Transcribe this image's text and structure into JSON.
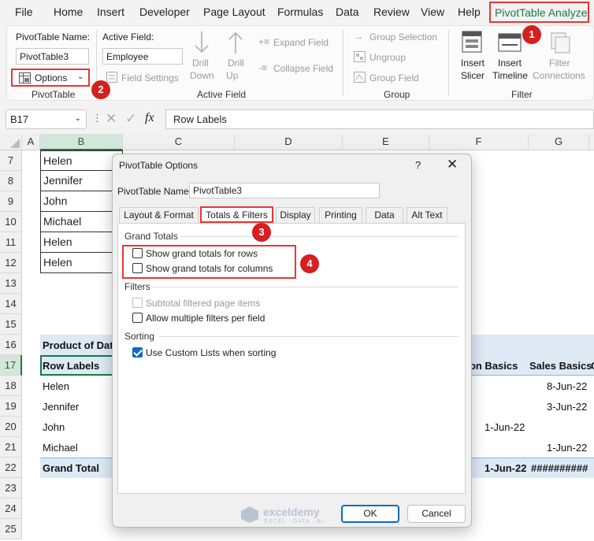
{
  "menu": {
    "items": [
      "File",
      "Home",
      "Insert",
      "Developer",
      "Page Layout",
      "Formulas",
      "Data",
      "Review",
      "View",
      "Help"
    ],
    "active": "PivotTable Analyze"
  },
  "ribbon": {
    "pivottable": {
      "name_label": "PivotTable Name:",
      "name_value": "PivotTable3",
      "options_label": "Options",
      "group_label": "PivotTable"
    },
    "active_field": {
      "label": "Active Field:",
      "value": "Employee",
      "field_settings": "Field Settings",
      "drill_down": [
        "Drill",
        "Down"
      ],
      "drill_up": [
        "Drill",
        "Up"
      ],
      "expand_field": "Expand Field",
      "collapse_field": "Collapse Field",
      "group_label": "Active Field"
    },
    "group": {
      "group_selection": "Group Selection",
      "ungroup": "Ungroup",
      "group_field": "Group Field",
      "group_label": "Group"
    },
    "filter": {
      "insert_slicer": [
        "Insert",
        "Slicer"
      ],
      "insert_timeline": [
        "Insert",
        "Timeline"
      ],
      "filter_connections": [
        "Filter",
        "Connections"
      ],
      "group_label": "Filter"
    }
  },
  "formula_bar": {
    "name_box": "B17",
    "fx": "fx",
    "formula": "Row Labels"
  },
  "grid": {
    "columns": [
      "A",
      "B",
      "C",
      "D",
      "E",
      "F",
      "G"
    ],
    "rows": [
      "7",
      "8",
      "9",
      "10",
      "11",
      "12",
      "13",
      "14",
      "15",
      "16",
      "17",
      "18",
      "19",
      "20",
      "21",
      "22",
      "23",
      "24",
      "25"
    ],
    "names_top": [
      "Helen",
      "Jennifer",
      "John",
      "Michael",
      "Helen",
      "Helen"
    ],
    "pivot_header": "Product of Dat",
    "row_labels": "Row Labels",
    "col_header_f": "tion Basics",
    "col_header_g": "Sales Basics",
    "col_header_h": "C",
    "pivot_rows": [
      "Helen",
      "Jennifer",
      "John",
      "Michael"
    ],
    "grand_total": "Grand Total",
    "values_g": [
      "8-Jun-22",
      "3-Jun-22",
      "",
      "1-Jun-22"
    ],
    "values_f": [
      "",
      "",
      "1-Jun-22",
      ""
    ],
    "grand_total_f": "1-Jun-22",
    "grand_total_g": "##########"
  },
  "dialog": {
    "title": "PivotTable Options",
    "help": "?",
    "name_label": "PivotTable Name:",
    "name_value": "PivotTable3",
    "tabs": [
      "Layout & Format",
      "Totals & Filters",
      "Display",
      "Printing",
      "Data",
      "Alt Text"
    ],
    "active_tab": "Totals & Filters",
    "sections": {
      "grand_totals": "Grand Totals",
      "filters": "Filters",
      "sorting": "Sorting"
    },
    "options": {
      "rows": {
        "label": "Show grand totals for rows",
        "checked": false
      },
      "columns": {
        "label": "Show grand totals for columns",
        "checked": false
      },
      "subtotal": {
        "label": "Subtotal filtered page items",
        "checked": false,
        "disabled": true
      },
      "multiple": {
        "label": "Allow multiple filters per field",
        "checked": false
      },
      "custom_lists": {
        "label": "Use Custom Lists when sorting",
        "checked": true
      }
    },
    "ok": "OK",
    "cancel": "Cancel"
  },
  "badges": [
    "1",
    "2",
    "3",
    "4"
  ],
  "watermark": {
    "name": "exceldemy",
    "tagline": "EXCEL · DATA · BI"
  },
  "colors": {
    "highlight_red": "#e33333",
    "excel_green": "#1a7a3e",
    "checkbox_blue": "#0f6cbd"
  }
}
